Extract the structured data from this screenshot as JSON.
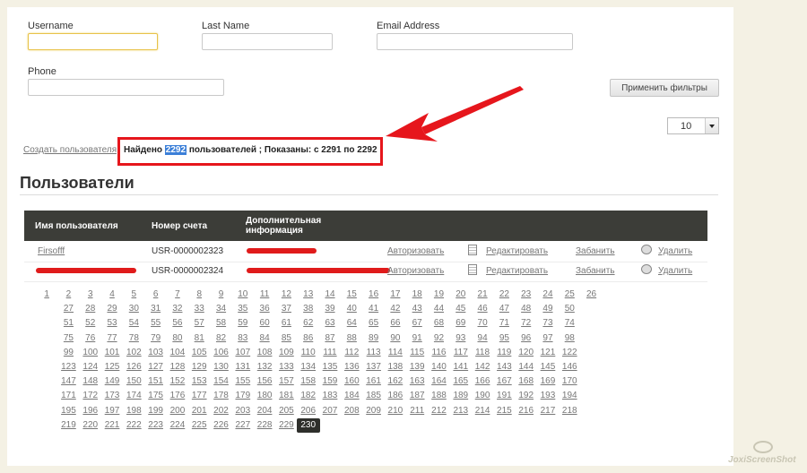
{
  "filters": {
    "username_label": "Username",
    "lastname_label": "Last Name",
    "email_label": "Email Address",
    "phone_label": "Phone",
    "apply_label": "Применить фильтры",
    "per_page": "10"
  },
  "summary": {
    "create_user_link": "Создать пользователя",
    "found_prefix": "Найдено",
    "found_count": "2292",
    "found_suffix": "пользователей ; Показаны: с 2291 по 2292"
  },
  "page_title": "Пользователи",
  "table": {
    "headers": [
      "Имя пользователя",
      "Номер счета",
      "Дополнительная информация"
    ],
    "rows": [
      {
        "name": "Firsofff",
        "account": "USR-0000002323",
        "authorize": "Авторизовать",
        "edit": "Редактировать",
        "ban": "Забанить",
        "delete": "Удалить"
      },
      {
        "name": "",
        "account": "USR-0000002324",
        "authorize": "Авторизовать",
        "edit": "Редактировать",
        "ban": "Забанить",
        "delete": "Удалить"
      }
    ]
  },
  "pagination": {
    "first_page": 1,
    "last_page": 230,
    "current_page": 230
  },
  "annotation": {
    "box_color": "#e6161c",
    "arrow_color": "#e6161c"
  },
  "watermark": "JoxiScreenShot"
}
